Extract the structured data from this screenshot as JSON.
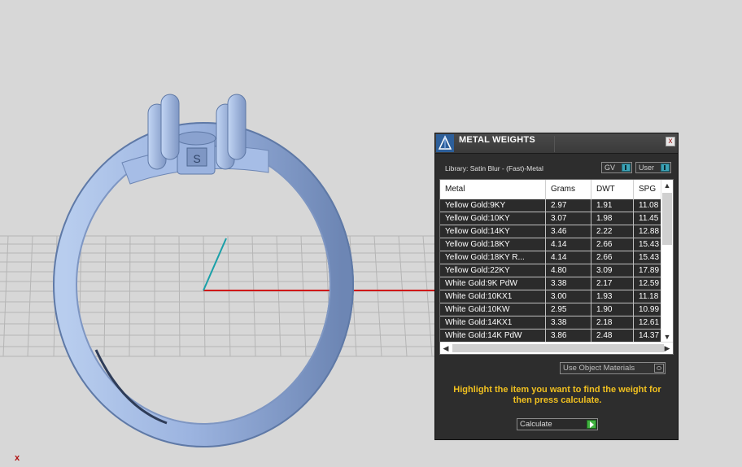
{
  "panel": {
    "title": "METAL WEIGHTS",
    "close_label": "x",
    "library_label": "Library: Satin Blur - (Fast)-Metal",
    "gv_toggle_label": "GV",
    "user_toggle_label": "User",
    "columns": [
      "Metal",
      "Grams",
      "DWT",
      "SPG"
    ],
    "rows": [
      {
        "metal": "Yellow Gold:9KY",
        "grams": "2.97",
        "dwt": "1.91",
        "spg": "11.08"
      },
      {
        "metal": "Yellow Gold:10KY",
        "grams": "3.07",
        "dwt": "1.98",
        "spg": "11.45"
      },
      {
        "metal": "Yellow Gold:14KY",
        "grams": "3.46",
        "dwt": "2.22",
        "spg": "12.88"
      },
      {
        "metal": "Yellow Gold:18KY",
        "grams": "4.14",
        "dwt": "2.66",
        "spg": "15.43"
      },
      {
        "metal": "Yellow Gold:18KY R...",
        "grams": "4.14",
        "dwt": "2.66",
        "spg": "15.43"
      },
      {
        "metal": "Yellow Gold:22KY",
        "grams": "4.80",
        "dwt": "3.09",
        "spg": "17.89"
      },
      {
        "metal": "White Gold:9K PdW",
        "grams": "3.38",
        "dwt": "2.17",
        "spg": "12.59"
      },
      {
        "metal": "White Gold:10KX1",
        "grams": "3.00",
        "dwt": "1.93",
        "spg": "11.18"
      },
      {
        "metal": "White Gold:10KW",
        "grams": "2.95",
        "dwt": "1.90",
        "spg": "10.99"
      },
      {
        "metal": "White Gold:14KX1",
        "grams": "3.38",
        "dwt": "2.18",
        "spg": "12.61"
      },
      {
        "metal": "White Gold:14K PdW",
        "grams": "3.86",
        "dwt": "2.48",
        "spg": "14.37"
      }
    ],
    "use_object_materials_label": "Use Object Materials",
    "hint_text": "Highlight the item you want to find the weight for then press calculate.",
    "calculate_label": "Calculate"
  },
  "viewport": {
    "axis_label": "x",
    "colors": {
      "background": "#d7d7d7",
      "grid": "#b9b9b9",
      "ring": "#9db6e2",
      "x_axis": "#d01818",
      "y_axis": "#1aa0a8",
      "hint": "#f0c020"
    }
  }
}
